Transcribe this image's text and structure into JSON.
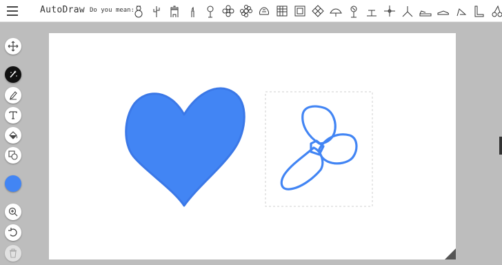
{
  "app": {
    "title": "AutoDraw"
  },
  "suggestions": {
    "label": "Do you mean:",
    "items": [
      "snowman-icon",
      "cactus-icon",
      "castle-icon",
      "candle-icon",
      "flower-icon",
      "flower-outline-icon",
      "daisy-icon",
      "cauliflower-icon",
      "hedge-icon",
      "square-pattern-icon",
      "diamond-flower-icon",
      "fan-icon",
      "palm-tree-icon",
      "windmill-icon",
      "cross-flower-icon",
      "tripod-icon",
      "sneaker-icon",
      "shoe-icon",
      "high-heel-icon",
      "boot-icon",
      "cherry-icon"
    ]
  },
  "tools": [
    "move-tool",
    "autodraw-tool",
    "draw-tool",
    "type-tool",
    "fill-tool",
    "shape-tool",
    "zoom-tool",
    "undo-tool",
    "delete-tool"
  ],
  "colors": {
    "selected": "#4285f4",
    "accent": "#4285f4"
  }
}
